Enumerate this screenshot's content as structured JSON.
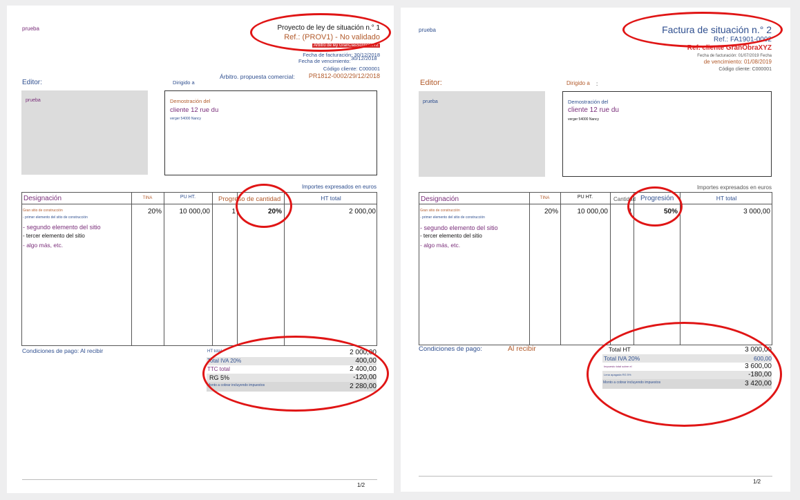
{
  "left": {
    "company": "prueba",
    "title": "Proyecto de ley de situación n.° 1",
    "ref": "Ref.: (PROV1) - No validado",
    "red_tag": "Árbitro de ley GranClasScripcoXYZ",
    "invoice_date": "Fecha de facturación: 30/12/2018",
    "due_date_label": "Fecha de vencimiento:",
    "due_date_value": "30/12/2018",
    "client_code": "Código cliente: C000001",
    "proposal_label": "Árbitro. propuesta comercial:",
    "proposal_value": "PR1812-0002/29/12/2018",
    "editor_label": "Editor:",
    "addressed_label": "Dirigido a",
    "sender_name": "prueba",
    "recipient_line1": "Demostración del",
    "recipient_line2": "cliente 12 rue du",
    "recipient_line3": "verger 54000 Nancy",
    "amounts_note": "Importes expresados en euros",
    "headers": {
      "designation": "Designación",
      "tax": "TINA",
      "unit_price": "PU HT.",
      "qty_progress": "Progreso de cantidad",
      "total": "HT total"
    },
    "row": {
      "tax": "20%",
      "unit_price": "10 000,00",
      "qty": "1",
      "progress": "20%",
      "total": "2 000,00"
    },
    "lines": [
      "Gran sitio de construcción",
      "- primer elemento del sitio de construcción",
      "- segundo elemento del sitio",
      "- tercer elemento del sitio",
      "- algo más, etc."
    ],
    "payment": "Condiciones de pago: Al recibir",
    "totals": [
      {
        "label": "HT total",
        "value": "2 000,00"
      },
      {
        "label": "Total IVA 20%",
        "value": "400,00"
      },
      {
        "label": "TTC total",
        "value": "2 400,00"
      },
      {
        "label": "RG 5%",
        "value": "-120,00"
      },
      {
        "label": "Monto a cobrar incluyendo impuestos",
        "value": "2 280,00"
      }
    ],
    "page_num": "1/2"
  },
  "right": {
    "company": "prueba",
    "title": "Factura de situación n.° 2",
    "ref": "Ref.: FA1901-0002",
    "red_tag": "Ref. cliente GranObraXYZ",
    "invoice_date": "Fecha de facturación: 01/07/2019 Fecha",
    "due_date": "de vencimiento: 01/08/2019",
    "client_code": "Código cliente: C000001",
    "editor_label": "Editor:",
    "addressed_label": "Dirigido a",
    "colon": ":",
    "sender_name": "prueba",
    "recipient_line1": "Demostración del",
    "recipient_line2": "cliente 12 rue du",
    "recipient_line3": "verger 54000 Nancy",
    "amounts_note": "Importes expresados en euros",
    "headers": {
      "designation": "Designación",
      "tax": "TINA",
      "unit_price": "PU HT.",
      "qty": "Cantidad",
      "progress": "Progresión",
      "total": "HT total"
    },
    "row": {
      "tax": "20%",
      "unit_price": "10 000,00",
      "qty": "1",
      "progress": "50%",
      "total": "3 000,00"
    },
    "lines": [
      "Gran sitio de construcción",
      "- primer elemento del sitio de construcción",
      "- segundo elemento del sitio",
      "- tercer elemento del sitio",
      "- algo más, etc."
    ],
    "payment_label": "Condiciones de pago:",
    "payment_value": "Al recibir",
    "totals": [
      {
        "label": "Total HT",
        "value": "3 000,00"
      },
      {
        "label": "Total IVA 20%",
        "value": "600,00"
      },
      {
        "label": "Impuesto total sobre el",
        "value": "3 600,00"
      },
      {
        "label": "Lena apagada RG 5%",
        "value": "-180,00"
      },
      {
        "label": "Monto a cobrar incluyendo impuestos",
        "value": "3 420,00"
      }
    ],
    "page_num": "1/2"
  },
  "colors": {
    "annotation": "#e01515",
    "purple": "#7a2e7a",
    "blue": "#2f4f8f",
    "brown": "#b25a2a"
  }
}
